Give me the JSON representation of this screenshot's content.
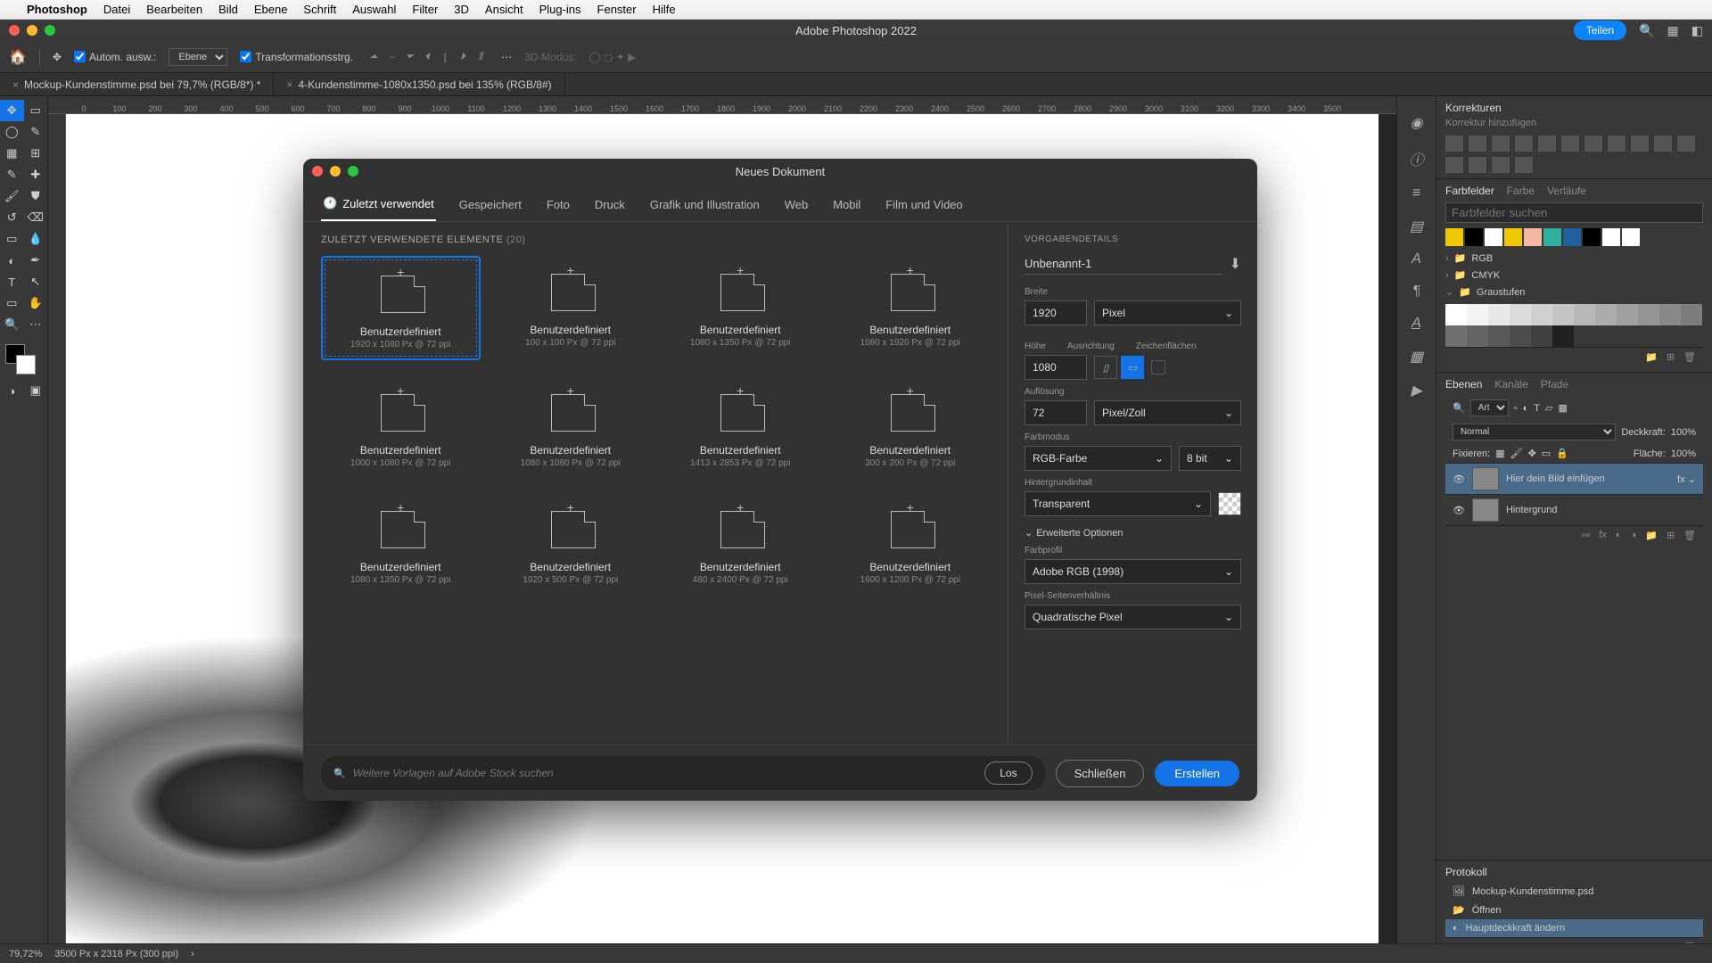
{
  "menubar": {
    "app": "Photoshop",
    "items": [
      "Datei",
      "Bearbeiten",
      "Bild",
      "Ebene",
      "Schrift",
      "Auswahl",
      "Filter",
      "3D",
      "Ansicht",
      "Plug-ins",
      "Fenster",
      "Hilfe"
    ]
  },
  "window": {
    "title": "Adobe Photoshop 2022",
    "share": "Teilen"
  },
  "options": {
    "auto_label": "Autom. ausw.:",
    "layer_sel": "Ebene",
    "transform": "Transformationsstrg.",
    "mode3d": "3D-Modus:"
  },
  "doc_tabs": [
    {
      "title": "Mockup-Kundenstimme.psd bei 79,7% (RGB/8*) *"
    },
    {
      "title": "4-Kundenstimme-1080x1350.psd bei 135% (RGB/8#)"
    }
  ],
  "ruler_ticks": [
    "0",
    "100",
    "200",
    "300",
    "400",
    "500",
    "600",
    "700",
    "800",
    "900",
    "1000",
    "1100",
    "1200",
    "1300",
    "1400",
    "1500",
    "1600",
    "1700",
    "1800",
    "1900",
    "2000",
    "2100",
    "2200",
    "2300",
    "2400",
    "2500",
    "2600",
    "2700",
    "2800",
    "2900",
    "3000",
    "3100",
    "3200",
    "3300",
    "3400",
    "3500"
  ],
  "right_panels": {
    "korrekturen": {
      "title": "Korrekturen",
      "hint": "Korrektur hinzufügen"
    },
    "swatches_tabs": [
      "Farbfelder",
      "Farbe",
      "Verläufe"
    ],
    "swatches_search_ph": "Farbfelder suchen",
    "swatch_colors": [
      "#f0c800",
      "#000",
      "#fff",
      "#f0c800",
      "#f5b8a0",
      "#30b0a0",
      "#2060a0",
      "#000",
      "#fff",
      "#fff"
    ],
    "tree": [
      {
        "label": "RGB",
        "open": false
      },
      {
        "label": "CMYK",
        "open": false
      },
      {
        "label": "Graustufen",
        "open": true
      }
    ],
    "grays": [
      "#fff",
      "#f4f4f4",
      "#e8e8e8",
      "#dcdcdc",
      "#d0d0d0",
      "#c4c4c4",
      "#b8b8b8",
      "#acacac",
      "#a0a0a0",
      "#949494",
      "#888",
      "#7c7c7c",
      "#707070",
      "#646464",
      "#585858",
      "#4c4c4c",
      "#404040",
      "#202020"
    ],
    "layers_tabs": [
      "Ebenen",
      "Kanäle",
      "Pfade"
    ],
    "layer_filter": "Art",
    "blend": "Normal",
    "opacity_label": "Deckkraft:",
    "opacity": "100%",
    "lock_label": "Fixieren:",
    "fill_label": "Fläche:",
    "fill": "100%",
    "layers": [
      {
        "name": "Hier dein Bild einfügen",
        "fx": "fx",
        "sel": true
      },
      {
        "name": "Hintergrund",
        "fx": "",
        "sel": false
      }
    ],
    "protokoll": {
      "title": "Protokoll",
      "doc": "Mockup-Kundenstimme.psd",
      "items": [
        "Öffnen",
        "Hauptdeckkraft ändern"
      ]
    }
  },
  "status": {
    "zoom": "79,72%",
    "dims": "3500 Px x 2318 Px (300 ppi)"
  },
  "modal": {
    "title": "Neues Dokument",
    "tabs": [
      "Zuletzt verwendet",
      "Gespeichert",
      "Foto",
      "Druck",
      "Grafik und Illustration",
      "Web",
      "Mobil",
      "Film und Video"
    ],
    "active_tab": 0,
    "presets_heading": "ZULETZT VERWENDETE ELEMENTE",
    "presets_count": "(20)",
    "presets": [
      {
        "name": "Benutzerdefiniert",
        "dims": "1920 x 1080 Px @ 72 ppi",
        "selected": true
      },
      {
        "name": "Benutzerdefiniert",
        "dims": "100 x 100 Px @ 72 ppi"
      },
      {
        "name": "Benutzerdefiniert",
        "dims": "1080 x 1350 Px @ 72 ppi"
      },
      {
        "name": "Benutzerdefiniert",
        "dims": "1080 x 1920 Px @ 72 ppi"
      },
      {
        "name": "Benutzerdefiniert",
        "dims": "1000 x 1080 Px @ 72 ppi"
      },
      {
        "name": "Benutzerdefiniert",
        "dims": "1080 x 1080 Px @ 72 ppi"
      },
      {
        "name": "Benutzerdefiniert",
        "dims": "1413 x 2853 Px @ 72 ppi"
      },
      {
        "name": "Benutzerdefiniert",
        "dims": "300 x 200 Px @ 72 ppi"
      },
      {
        "name": "Benutzerdefiniert",
        "dims": "1080 x 1350 Px @ 72 ppi"
      },
      {
        "name": "Benutzerdefiniert",
        "dims": "1920 x 500 Px @ 72 ppi"
      },
      {
        "name": "Benutzerdefiniert",
        "dims": "480 x 2400 Px @ 72 ppi"
      },
      {
        "name": "Benutzerdefiniert",
        "dims": "1600 x 1200 Px @ 72 ppi"
      }
    ],
    "details": {
      "heading": "VORGABENDETAILS",
      "name": "Unbenannt-1",
      "width_label": "Breite",
      "width": "1920",
      "unit": "Pixel",
      "height_label": "Höhe",
      "height": "1080",
      "orient_label": "Ausrichtung",
      "artboard_label": "Zeichenflächen",
      "res_label": "Auflösung",
      "res": "72",
      "res_unit": "Pixel/Zoll",
      "mode_label": "Farbmodus",
      "mode": "RGB-Farbe",
      "depth": "8 bit",
      "bg_label": "Hintergrundinhalt",
      "bg": "Transparent",
      "adv_label": "Erweiterte Optionen",
      "profile_label": "Farbprofil",
      "profile": "Adobe RGB (1998)",
      "par_label": "Pixel-Seitenverhältnis",
      "par": "Quadratische Pixel"
    },
    "stock_ph": "Weitere Vorlagen auf Adobe Stock suchen",
    "go": "Los",
    "close": "Schließen",
    "create": "Erstellen"
  }
}
